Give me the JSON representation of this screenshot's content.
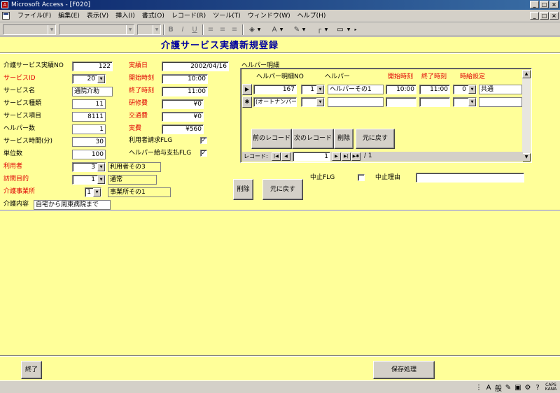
{
  "window": {
    "app_icon": "A",
    "title": "Microsoft Access - [F020]",
    "min": "_",
    "max": "□",
    "close": "×",
    "restore": "🗗"
  },
  "menu": [
    "ファイル(F)",
    "編集(E)",
    "表示(V)",
    "挿入(I)",
    "書式(O)",
    "レコード(R)",
    "ツール(T)",
    "ウィンドウ(W)",
    "ヘルプ(H)"
  ],
  "toolbar": {
    "bold": "B",
    "italic": "I",
    "underline": "U"
  },
  "form": {
    "title": "介護サービス実績新規登録",
    "fields": {
      "record_no_label": "介護サービス実績NO",
      "record_no": "122",
      "service_id_label": "サービスID",
      "service_id": "20",
      "service_name_label": "サービス名",
      "service_name": "通院介助",
      "service_type_label": "サービス種類",
      "service_type": "11",
      "service_item_label": "サービス項目",
      "service_item": "8111",
      "helper_count_label": "ヘルパー数",
      "helper_count": "1",
      "service_minutes_label": "サービス時間(分)",
      "service_minutes": "30",
      "unit_count_label": "単位数",
      "unit_count": "100",
      "user_label": "利用者",
      "user_id": "3",
      "user_name": "利用者その3",
      "visit_purpose_label": "訪問目的",
      "visit_purpose_id": "1",
      "visit_purpose_name": "通常",
      "provider_label": "介護事業所",
      "provider_id": "1",
      "provider_name": "事業所その1",
      "care_content_label": "介護内容",
      "care_content": "自宅から周東病院まで",
      "actual_date_label": "実績日",
      "actual_date": "2002/04/16",
      "start_time_label": "開始時刻",
      "start_time": "10:00",
      "end_time_label": "終了時刻",
      "end_time": "11:00",
      "training_fee_label": "研修費",
      "training_fee": "¥0",
      "transport_fee_label": "交通費",
      "transport_fee": "¥0",
      "actual_cost_label": "実費",
      "actual_cost": "¥560",
      "user_bill_flg_label": "利用者請求FLG",
      "user_bill_flg": "✓",
      "helper_pay_flg_label": "ヘルパー給与支払FLG",
      "helper_pay_flg": "✓",
      "cancel_flg_label": "中止FLG",
      "cancel_reason_label": "中止理由",
      "cancel_reason": ""
    },
    "buttons": {
      "delete": "削除",
      "undo": "元に戻す",
      "exit": "終了",
      "save": "保存処理"
    }
  },
  "subform": {
    "label": "ヘルパー明細",
    "headers": {
      "detail_no": "ヘルパー明細NO",
      "helper": "ヘルパー",
      "start": "開始時刻",
      "end": "終了時刻",
      "rate": "時給設定"
    },
    "row": {
      "selector": "▶",
      "detail_no": "167",
      "helper_id": "1",
      "helper_name": "ヘルパーその1",
      "start": "10:00",
      "end": "11:00",
      "rate_id": "0",
      "rate_name": "共通"
    },
    "new_row": {
      "selector": "✱",
      "detail_no": "(オートナンバー)"
    },
    "buttons": {
      "prev": "前のレコード",
      "next": "次のレコード",
      "delete": "削除",
      "undo": "元に戻す"
    },
    "nav": {
      "label": "レコード:",
      "current": "1",
      "total": "/ 1"
    }
  },
  "statusbar": {
    "ime": [
      "A",
      "般",
      "CAPS KANA"
    ]
  }
}
